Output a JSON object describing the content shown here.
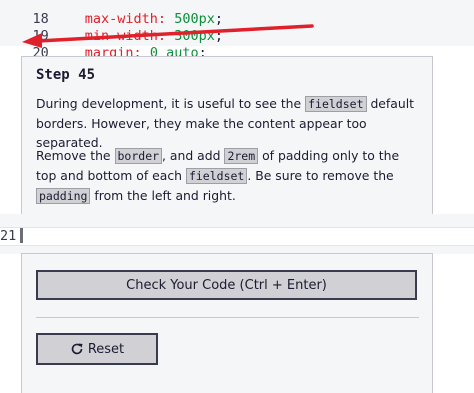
{
  "code_lines": [
    {
      "num": "18",
      "prop": "max-width:",
      "value": "500px",
      "tail": ";"
    },
    {
      "num": "19",
      "prop": "min-width:",
      "value": "300px",
      "tail": ";"
    },
    {
      "num": "20",
      "prop": "margin:",
      "value": "0",
      "value2": "auto",
      "tail": ";"
    }
  ],
  "line21": {
    "num": "21"
  },
  "step": {
    "title": "Step 45",
    "p1_a": "During development, it is useful to see the ",
    "p1_code": "fieldset",
    "p1_b": " default borders. However, they make the content appear too separated.",
    "p2_a": "Remove the ",
    "p2_code1": "border",
    "p2_b": ", and add ",
    "p2_code2": "2rem",
    "p2_c": " of padding only to the top and bottom of each ",
    "p2_code3": "fieldset",
    "p2_d": ". Be sure to remove the ",
    "p2_code4": "padding",
    "p2_e": " from the left and right."
  },
  "buttons": {
    "check_label": "Check Your Code (Ctrl + Enter)",
    "reset_label": "Reset"
  },
  "colors": {
    "arrow": "#e0202a",
    "accent": "#1b1b32"
  }
}
